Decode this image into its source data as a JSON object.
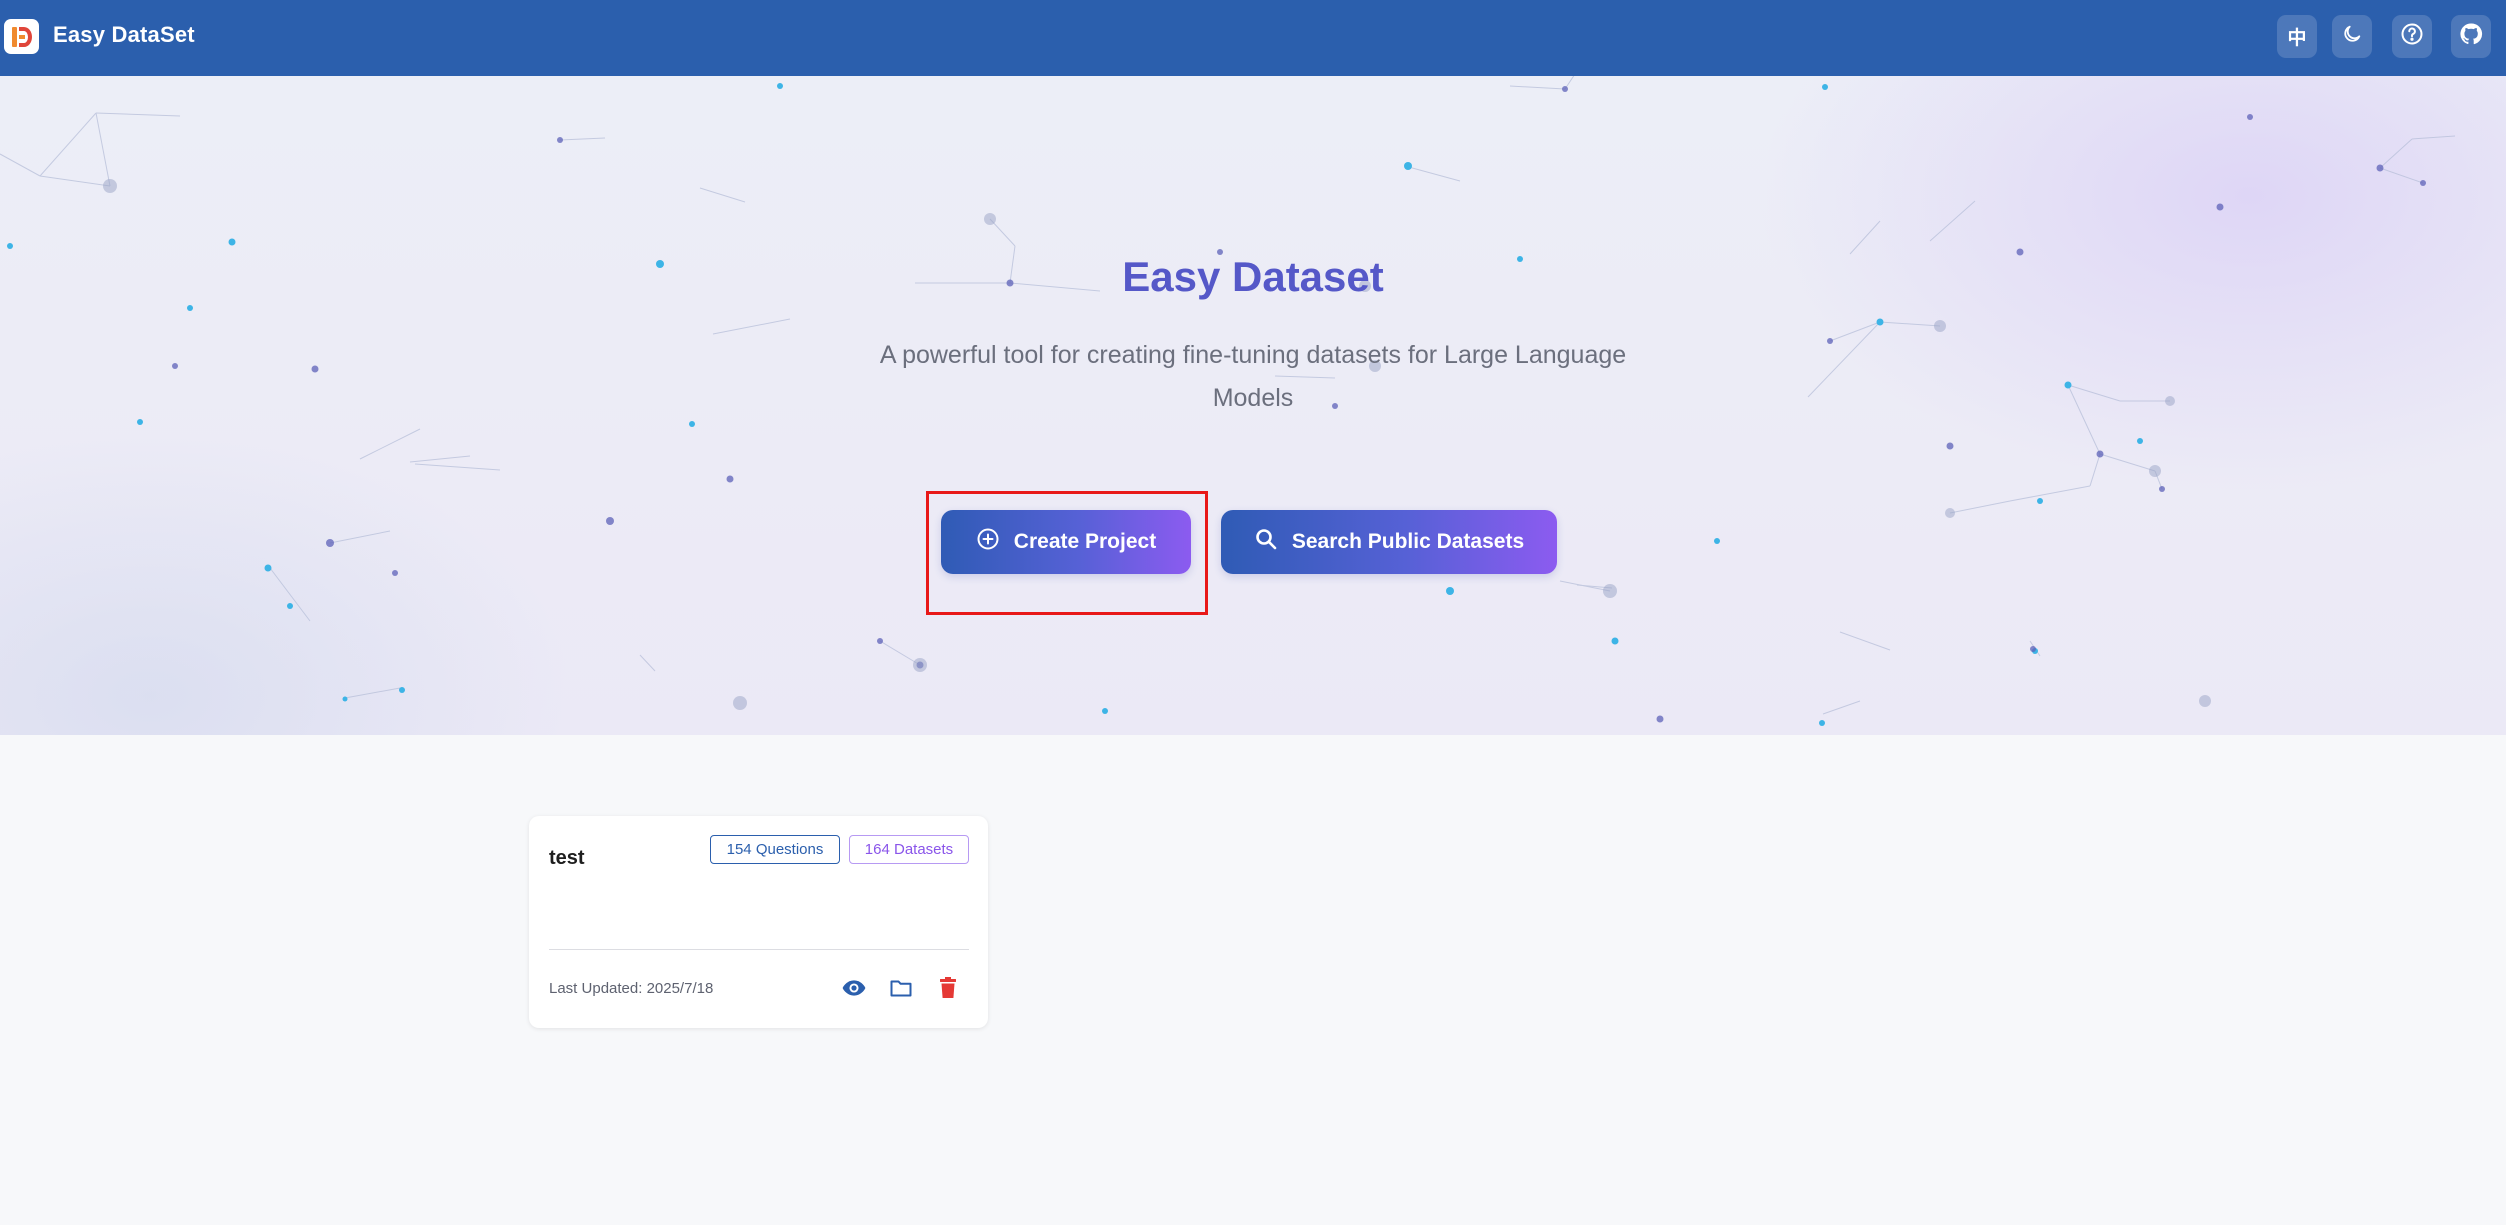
{
  "header": {
    "app_name": "Easy DataSet",
    "language_button_label": "中",
    "icons": [
      "logo-icon",
      "moon-icon",
      "help-icon",
      "github-icon"
    ]
  },
  "hero": {
    "title": "Easy Dataset",
    "subtitle": "A powerful tool for creating fine-tuning datasets for Large Language Models",
    "create_project_label": "Create Project",
    "search_datasets_label": "Search Public Datasets"
  },
  "projects": [
    {
      "name": "test",
      "questions_badge": "154 Questions",
      "datasets_badge": "164 Datasets",
      "last_updated": "Last Updated: 2025/7/18",
      "actions": [
        "eye-icon",
        "folder-icon",
        "trash-icon"
      ]
    }
  ],
  "colors": {
    "header_bg": "#2b5fad",
    "title_color": "#5558c8",
    "button_gradient_start": "#2f5bb5",
    "button_gradient_end": "#8c5bf0",
    "highlight_border": "#e81818",
    "questions_badge": "#2b5fad",
    "datasets_badge": "#8a55ea",
    "delete_icon": "#e53935"
  }
}
